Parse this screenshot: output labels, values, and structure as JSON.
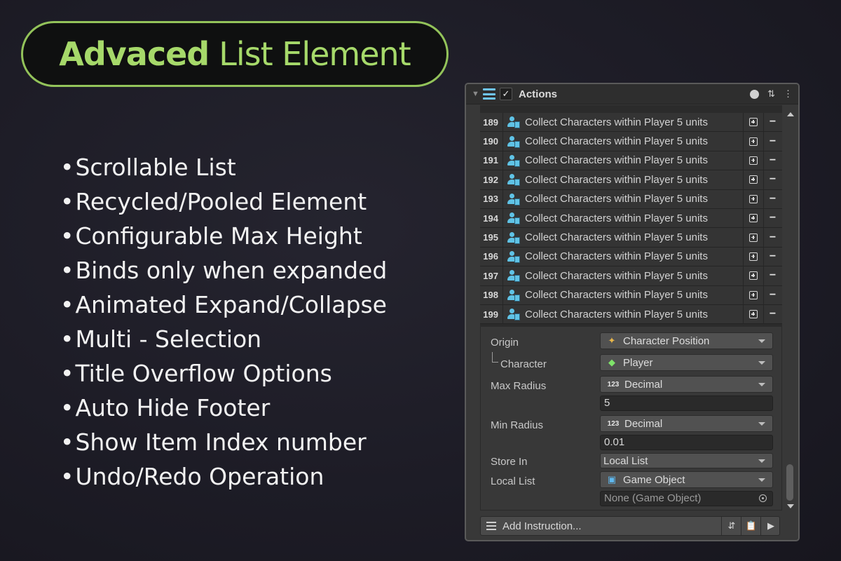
{
  "banner": {
    "title_bold": "Advaced",
    "title_rest": "List Element"
  },
  "features": [
    "Scrollable List",
    "Recycled/Pooled Element",
    "Configurable Max Height",
    "Binds only when expanded",
    "Animated Expand/Collapse",
    "Multi - Selection",
    "Title Overflow Options",
    "Auto Hide Footer",
    "Show Item Index number",
    "Undo/Redo Operation"
  ],
  "panel": {
    "title": "Actions",
    "enabled": true,
    "rows": [
      {
        "index": "189",
        "text": "Collect Characters within Player 5 units"
      },
      {
        "index": "190",
        "text": "Collect Characters within Player 5 units"
      },
      {
        "index": "191",
        "text": "Collect Characters within Player 5 units"
      },
      {
        "index": "192",
        "text": "Collect Characters within Player 5 units"
      },
      {
        "index": "193",
        "text": "Collect Characters within Player 5 units"
      },
      {
        "index": "194",
        "text": "Collect Characters within Player 5 units"
      },
      {
        "index": "195",
        "text": "Collect Characters within Player 5 units"
      },
      {
        "index": "196",
        "text": "Collect Characters within Player 5 units"
      },
      {
        "index": "197",
        "text": "Collect Characters within Player 5 units"
      },
      {
        "index": "198",
        "text": "Collect Characters within Player 5 units"
      },
      {
        "index": "199",
        "text": "Collect Characters within Player 5 units"
      }
    ],
    "props": {
      "origin_label": "Origin",
      "origin_value": "Character Position",
      "character_label": "Character",
      "character_value": "Player",
      "max_radius_label": "Max Radius",
      "max_radius_type": "Decimal",
      "max_radius_value": "5",
      "min_radius_label": "Min Radius",
      "min_radius_type": "Decimal",
      "min_radius_value": "0.01",
      "store_in_label": "Store In",
      "store_in_value": "Local List",
      "local_list_label": "Local List",
      "local_list_type": "Game Object",
      "local_list_value": "None (Game Object)",
      "number_icon_text": "123"
    },
    "footer": {
      "add_label": "Add Instruction..."
    }
  },
  "colors": {
    "accent_green": "#a6d96a",
    "accent_blue": "#6fc5f5",
    "panel_bg": "#383838"
  }
}
